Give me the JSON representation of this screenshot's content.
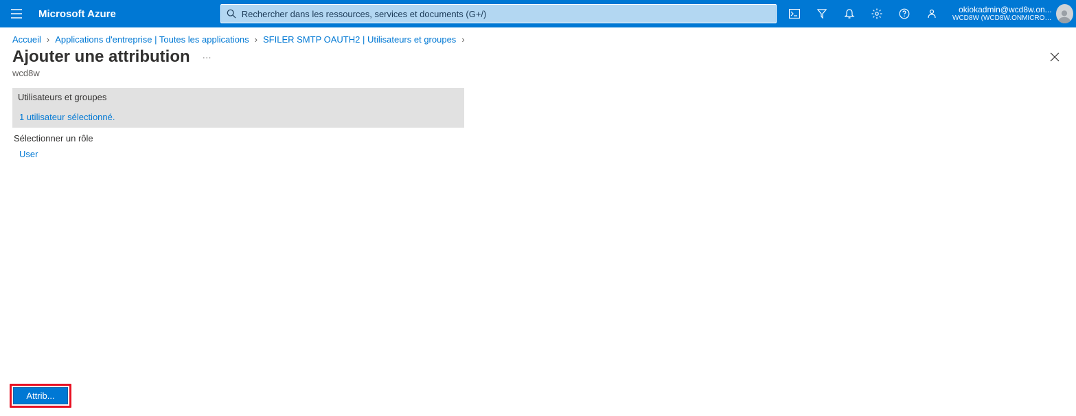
{
  "header": {
    "brand": "Microsoft Azure",
    "search_placeholder": "Rechercher dans les ressources, services et documents (G+/)",
    "account_email": "okiokadmin@wcd8w.on...",
    "account_tenant": "WCD8W (WCD8W.ONMICROSOF..."
  },
  "breadcrumb": {
    "items": [
      {
        "label": "Accueil"
      },
      {
        "label": "Applications d'entreprise | Toutes les applications"
      },
      {
        "label": "SFILER SMTP OAUTH2 | Utilisateurs et groupes"
      }
    ]
  },
  "page": {
    "title": "Ajouter une attribution",
    "subtitle": "wcd8w"
  },
  "panel": {
    "users_groups_label": "Utilisateurs et groupes",
    "users_groups_value": "1 utilisateur sélectionné.",
    "role_label": "Sélectionner un rôle",
    "role_value": "User"
  },
  "footer": {
    "assign_label": "Attrib..."
  }
}
